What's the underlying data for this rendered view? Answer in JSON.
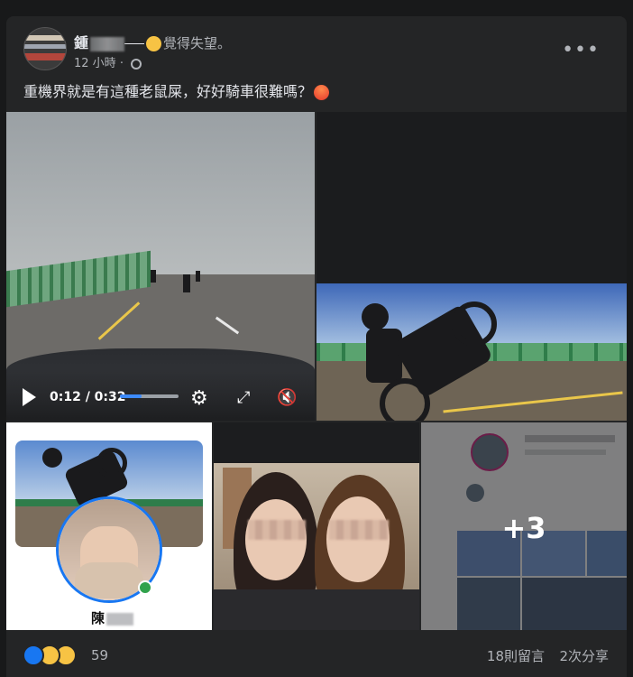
{
  "post": {
    "author_prefix": "鍾",
    "feeling": "覺得失望。",
    "timestamp": "12 小時",
    "text": "重機界就是有這種老鼠屎，好好騎車很難嗎？",
    "more_label": "•••"
  },
  "video": {
    "time": "0:12 / 0:32",
    "progress": 0.37
  },
  "tiles": {
    "profile_name": "陳",
    "more_photos": "+3"
  },
  "footer": {
    "reaction_count": "59",
    "comments": "18則留言",
    "shares": "2次分享"
  },
  "colors": {
    "background": "#18191a",
    "card": "#242526",
    "accent": "#3d8bfd"
  },
  "icons": [
    "globe-icon",
    "more-icon",
    "play-icon",
    "settings-icon",
    "fullscreen-icon",
    "mute-icon",
    "like-reaction-icon",
    "wow-reaction-icon",
    "haha-reaction-icon",
    "disappointed-emoji",
    "angry-emoji"
  ]
}
